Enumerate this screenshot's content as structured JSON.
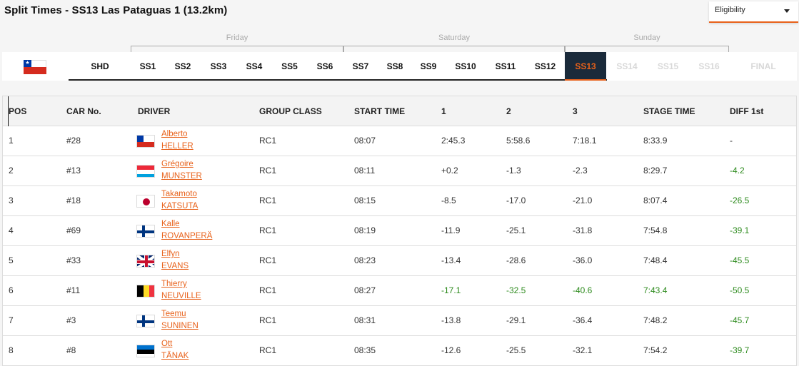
{
  "page_title": "Split Times - SS13 Las Pataguas 1 (13.2km)",
  "eligibility": {
    "value": "Eligibility",
    "icon": "chevron-down-icon"
  },
  "days": [
    "Friday",
    "Saturday",
    "Sunday"
  ],
  "country_flag": "flag-chile-icon",
  "stages": [
    {
      "label": "SHD",
      "state": "normal"
    },
    {
      "label": "SS1",
      "state": "normal"
    },
    {
      "label": "SS2",
      "state": "normal"
    },
    {
      "label": "SS3",
      "state": "normal"
    },
    {
      "label": "SS4",
      "state": "normal"
    },
    {
      "label": "SS5",
      "state": "normal"
    },
    {
      "label": "SS6",
      "state": "normal"
    },
    {
      "label": "SS7",
      "state": "normal"
    },
    {
      "label": "SS8",
      "state": "normal"
    },
    {
      "label": "SS9",
      "state": "normal"
    },
    {
      "label": "SS10",
      "state": "normal"
    },
    {
      "label": "SS11",
      "state": "normal"
    },
    {
      "label": "SS12",
      "state": "normal"
    },
    {
      "label": "SS13",
      "state": "active"
    },
    {
      "label": "SS14",
      "state": "disabled"
    },
    {
      "label": "SS15",
      "state": "disabled"
    },
    {
      "label": "SS16",
      "state": "disabled"
    },
    {
      "label": "FINAL",
      "state": "disabled"
    }
  ],
  "table": {
    "headers": [
      "POS",
      "CAR No.",
      "DRIVER",
      "GROUP CLASS",
      "START TIME",
      "1",
      "2",
      "3",
      "STAGE TIME",
      "DIFF 1st"
    ],
    "rows": [
      {
        "pos": "1",
        "car": "#28",
        "first": "Alberto",
        "last": "HELLER",
        "flag": "chile",
        "group": "RC1",
        "start": "08:07",
        "s1": "2:45.3",
        "s2": "5:58.6",
        "s3": "7:18.1",
        "stage": "8:33.9",
        "diff": "-",
        "green": []
      },
      {
        "pos": "2",
        "car": "#13",
        "first": "Grégoire",
        "last": "MUNSTER",
        "flag": "luxembourg",
        "group": "RC1",
        "start": "08:11",
        "s1": "+0.2",
        "s2": "-1.3",
        "s3": "-2.3",
        "stage": "8:29.7",
        "diff": "-4.2",
        "green": [
          "diff"
        ]
      },
      {
        "pos": "3",
        "car": "#18",
        "first": "Takamoto",
        "last": "KATSUTA",
        "flag": "japan",
        "group": "RC1",
        "start": "08:15",
        "s1": "-8.5",
        "s2": "-17.0",
        "s3": "-21.0",
        "stage": "8:07.4",
        "diff": "-26.5",
        "green": [
          "diff"
        ]
      },
      {
        "pos": "4",
        "car": "#69",
        "first": "Kalle",
        "last": "ROVANPERÄ",
        "flag": "finland",
        "group": "RC1",
        "start": "08:19",
        "s1": "-11.9",
        "s2": "-25.1",
        "s3": "-31.8",
        "stage": "7:54.8",
        "diff": "-39.1",
        "green": [
          "diff"
        ]
      },
      {
        "pos": "5",
        "car": "#33",
        "first": "Elfyn",
        "last": "EVANS",
        "flag": "uk",
        "group": "RC1",
        "start": "08:23",
        "s1": "-13.4",
        "s2": "-28.6",
        "s3": "-36.0",
        "stage": "7:48.4",
        "diff": "-45.5",
        "green": [
          "diff"
        ]
      },
      {
        "pos": "6",
        "car": "#11",
        "first": "Thierry",
        "last": "NEUVILLE",
        "flag": "belgium",
        "group": "RC1",
        "start": "08:27",
        "s1": "-17.1",
        "s2": "-32.5",
        "s3": "-40.6",
        "stage": "7:43.4",
        "diff": "-50.5",
        "green": [
          "s1",
          "s2",
          "s3",
          "stage",
          "diff"
        ]
      },
      {
        "pos": "7",
        "car": "#3",
        "first": "Teemu",
        "last": "SUNINEN",
        "flag": "finland",
        "group": "RC1",
        "start": "08:31",
        "s1": "-13.8",
        "s2": "-29.1",
        "s3": "-36.4",
        "stage": "7:48.2",
        "diff": "-45.7",
        "green": [
          "diff"
        ]
      },
      {
        "pos": "8",
        "car": "#8",
        "first": "Ott",
        "last": "TÄNAK",
        "flag": "estonia",
        "group": "RC1",
        "start": "08:35",
        "s1": "-12.6",
        "s2": "-25.5",
        "s3": "-32.1",
        "stage": "7:54.2",
        "diff": "-39.7",
        "green": [
          "diff"
        ]
      }
    ]
  },
  "colors": {
    "accent": "#e8611a",
    "positive": "#2e8b1e",
    "active_stage_bg": "#1a2a3a"
  }
}
